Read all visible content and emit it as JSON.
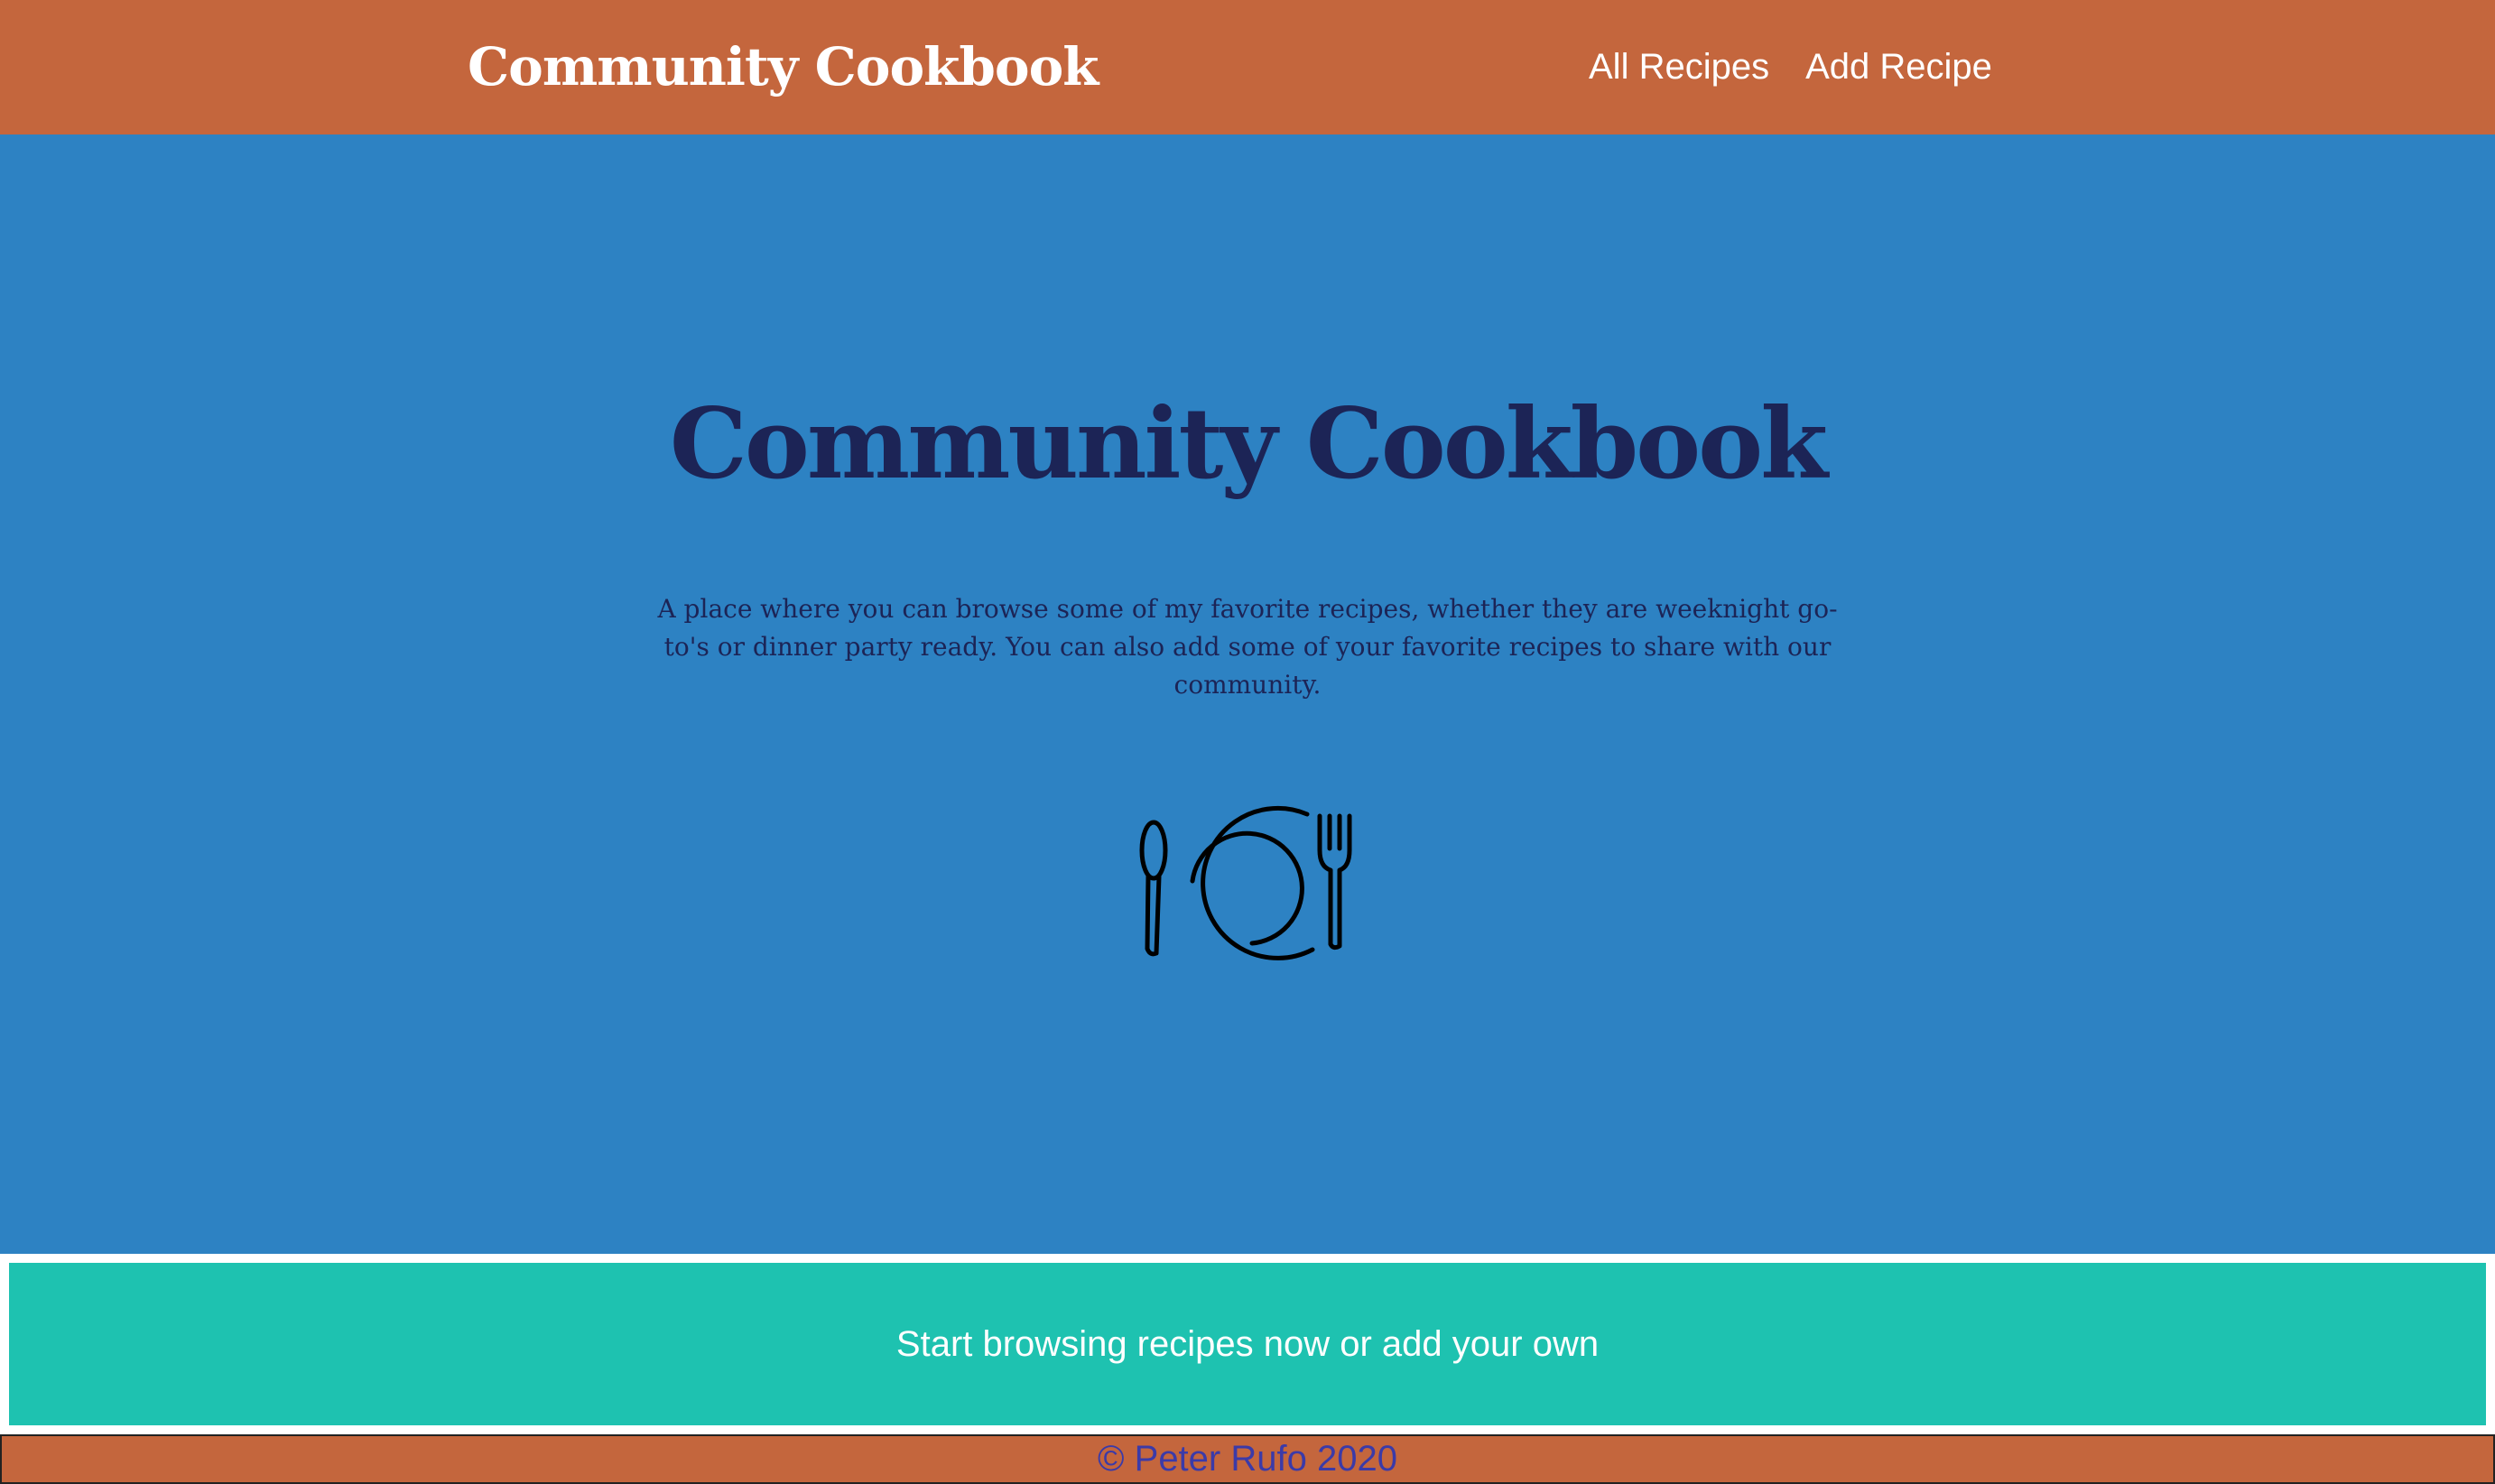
{
  "navbar": {
    "brand": "Community Cookbook",
    "links": [
      {
        "label": "All Recipes"
      },
      {
        "label": "Add Recipe"
      }
    ]
  },
  "hero": {
    "title": "Community Cookbook",
    "description": "A place where you can browse some of my favorite recipes, whether they are weeknight go-to's or dinner party ready. You can also add some of your favorite recipes to share with our community.",
    "icon": "plate-spoon-fork-icon"
  },
  "cta": {
    "label": "Start browsing recipes now or add your own"
  },
  "footer": {
    "text": "© Peter Rufo 2020"
  },
  "colors": {
    "navbar_bg": "#c4663d",
    "hero_bg": "#2d82c3",
    "hero_text": "#1c2456",
    "cta_bg": "#1ec2b0",
    "footer_text": "#3b3aa8"
  }
}
